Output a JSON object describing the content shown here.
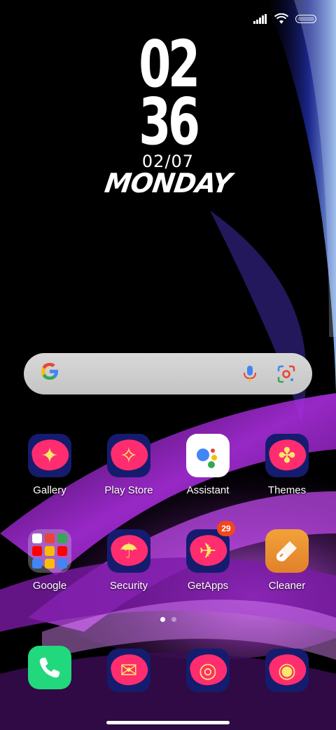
{
  "status_bar": {
    "signal_icon": "cellular-signal-icon",
    "wifi_icon": "wifi-icon",
    "battery_icon": "battery-icon"
  },
  "clock": {
    "hours": "02",
    "minutes": "36",
    "date": "02/07",
    "day": "MONDAY"
  },
  "search_bar": {
    "logo": "G",
    "mic_icon": "microphone-icon",
    "lens_icon": "google-lens-icon"
  },
  "apps_row1": [
    {
      "label": "Gallery",
      "icon": "gallery-icon"
    },
    {
      "label": "Play Store",
      "icon": "play-store-icon"
    },
    {
      "label": "Assistant",
      "icon": "assistant-icon"
    },
    {
      "label": "Themes",
      "icon": "themes-icon"
    }
  ],
  "apps_row2": [
    {
      "label": "Google",
      "icon": "google-folder-icon"
    },
    {
      "label": "Security",
      "icon": "security-icon"
    },
    {
      "label": "GetApps",
      "icon": "getapps-icon",
      "badge": "29"
    },
    {
      "label": "Cleaner",
      "icon": "cleaner-icon"
    }
  ],
  "dock": [
    {
      "icon": "phone-icon"
    },
    {
      "icon": "messages-icon"
    },
    {
      "icon": "browser-icon"
    },
    {
      "icon": "camera-icon"
    }
  ],
  "page_indicator": {
    "pages": 2,
    "current": 1
  },
  "colors": {
    "themed_icon_bg": "#151c6e",
    "themed_icon_blob": "#ff2d6f",
    "themed_icon_glyph": "#f7e76a",
    "phone_green": "#22d87c",
    "cleaner_orange": "#e9912f",
    "badge_red": "#f2471c"
  }
}
